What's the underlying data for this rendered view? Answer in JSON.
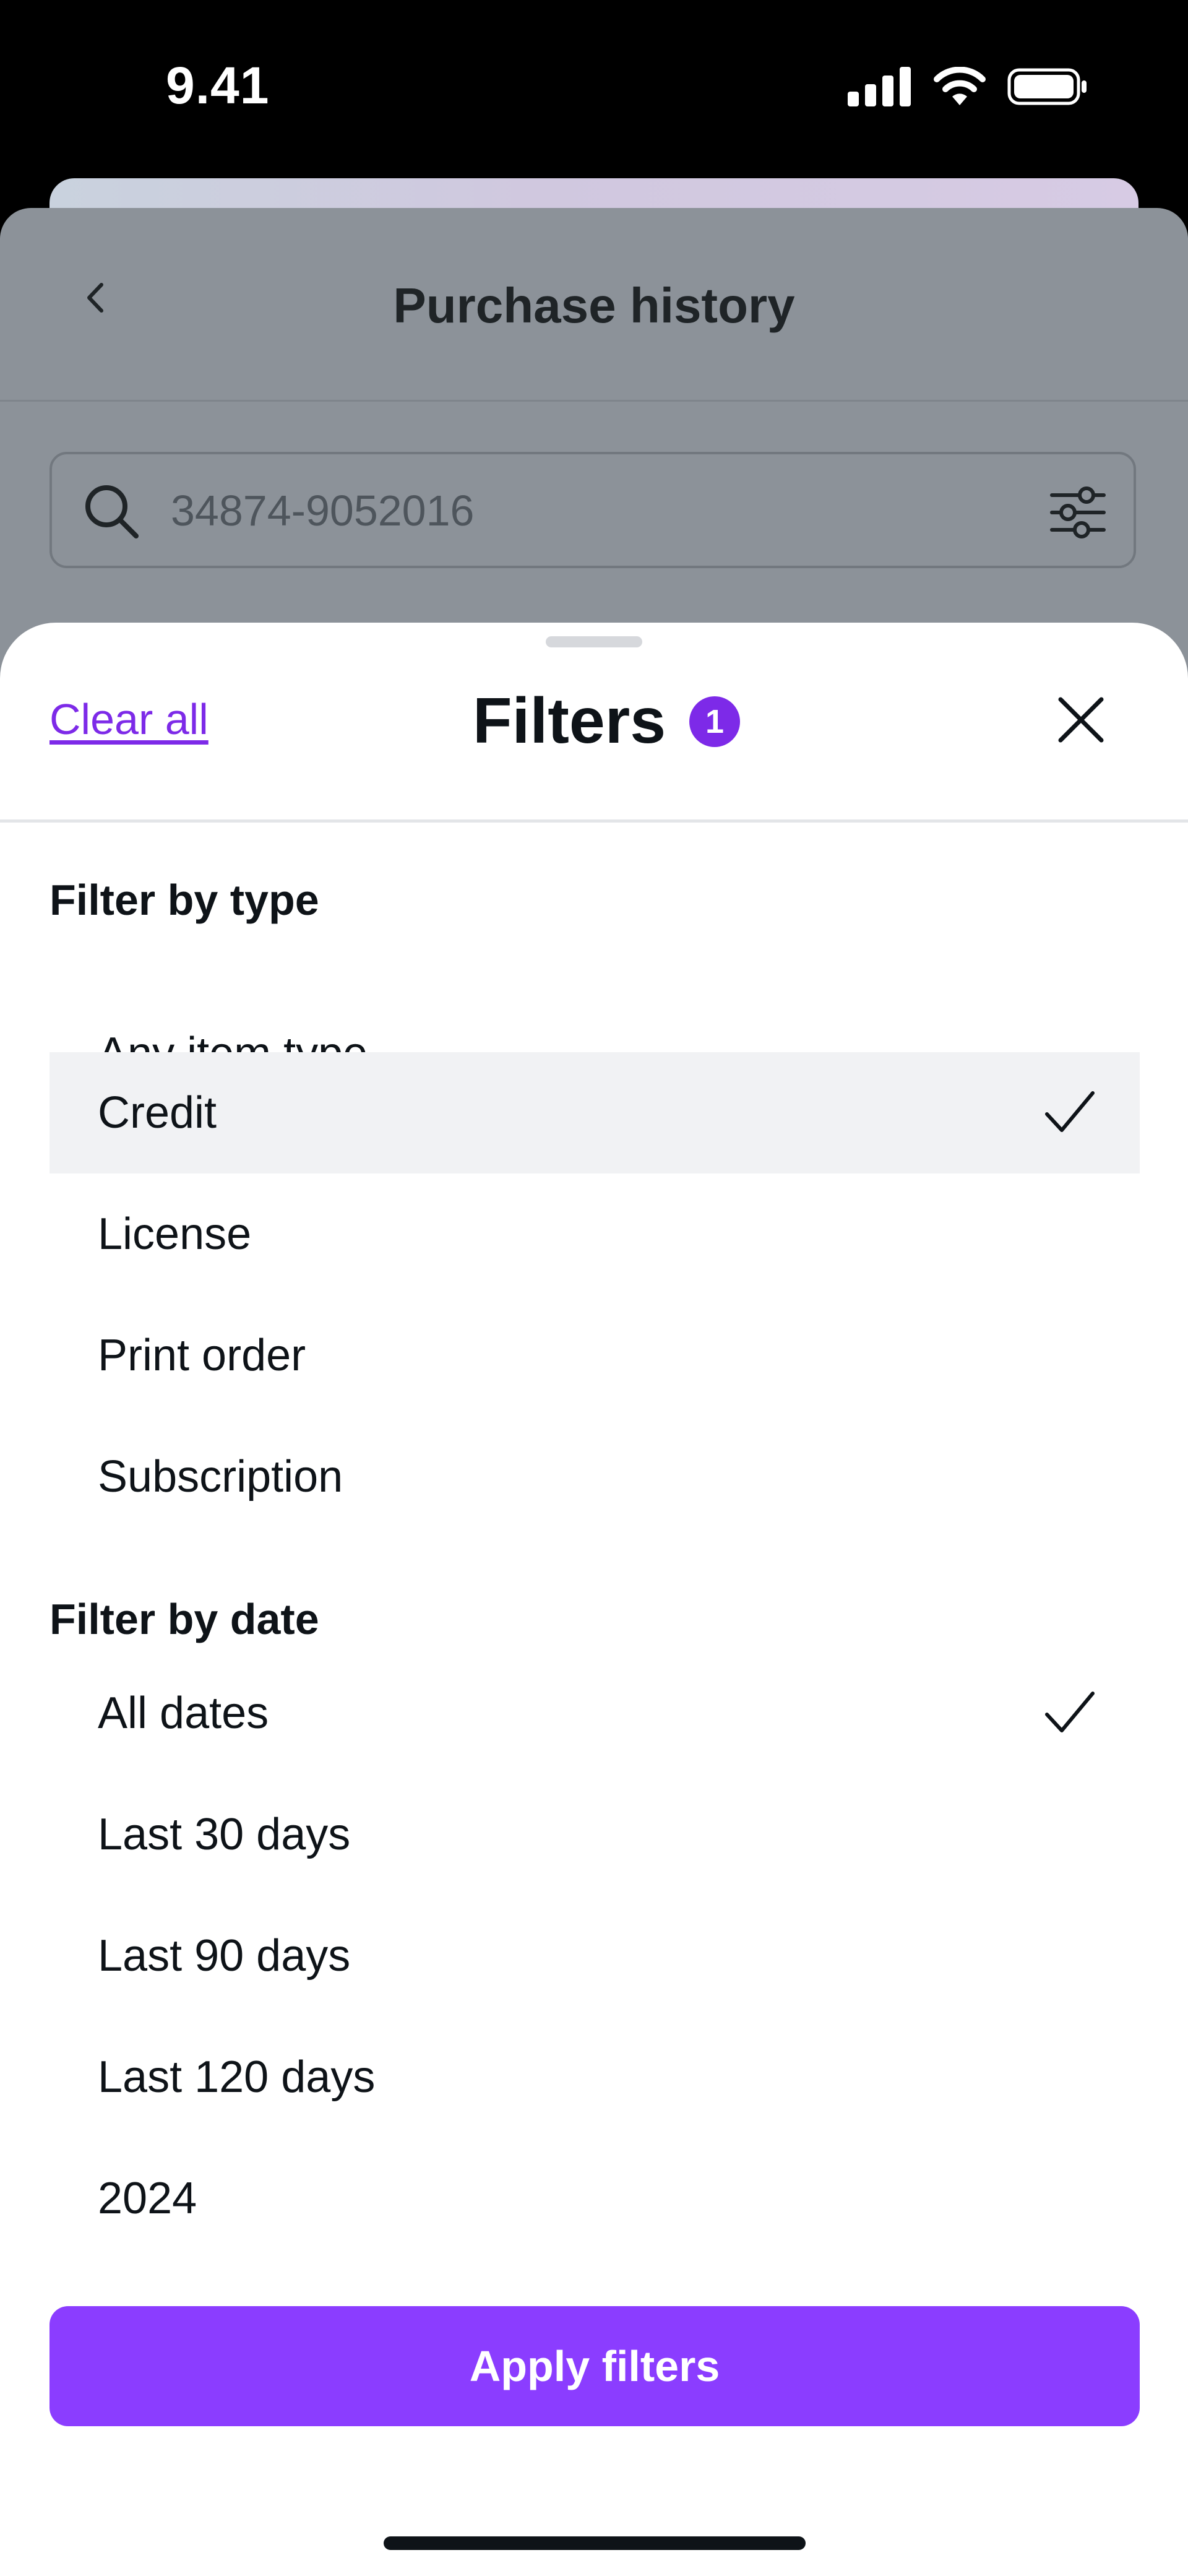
{
  "status_bar": {
    "time": "9.41",
    "icons": [
      "cellular-signal-icon",
      "wifi-icon",
      "battery-icon"
    ]
  },
  "background_page": {
    "title": "Purchase history",
    "back_icon": "chevron-left-icon",
    "search": {
      "value": "34874-9052016",
      "placeholder": "34874-9052016",
      "icon": "search-icon",
      "filter_icon": "sliders-icon"
    }
  },
  "filters_sheet": {
    "clear_all_label": "Clear all",
    "title": "Filters",
    "active_count": "1",
    "close_icon": "close-icon",
    "type_section": {
      "title": "Filter by type",
      "options": [
        {
          "label": "Any item type",
          "selected": false
        },
        {
          "label": "Credit",
          "selected": true
        },
        {
          "label": "License",
          "selected": false
        },
        {
          "label": "Print order",
          "selected": false
        },
        {
          "label": "Subscription",
          "selected": false
        }
      ]
    },
    "date_section": {
      "title": "Filter by date",
      "options": [
        {
          "label": "All dates",
          "selected": true
        },
        {
          "label": "Last 30 days",
          "selected": false
        },
        {
          "label": "Last 90 days",
          "selected": false
        },
        {
          "label": "Last 120 days",
          "selected": false
        },
        {
          "label": "2024",
          "selected": false
        }
      ]
    },
    "apply_label": "Apply filters"
  },
  "colors": {
    "accent": "#8b3dff",
    "link": "#7d2ae8",
    "overlay": "#8c9299",
    "selected_row": "#f1f2f4"
  }
}
